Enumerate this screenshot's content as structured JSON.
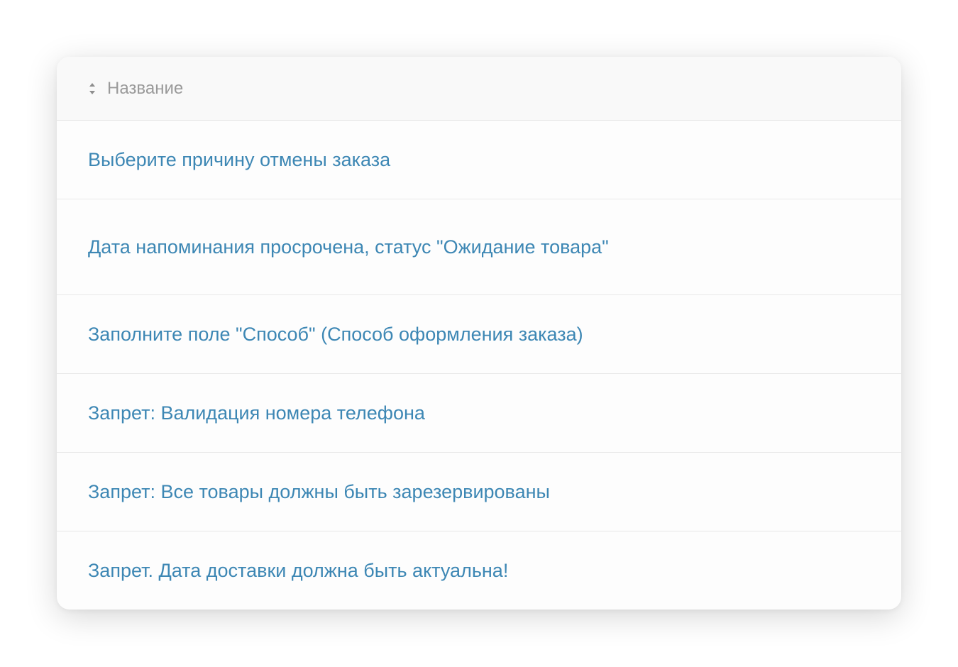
{
  "table": {
    "header": {
      "column_label": "Название",
      "sort_icon": "sort-updown-icon"
    },
    "rows": [
      {
        "label": "Выберите причину отмены заказа"
      },
      {
        "label": "Дата напоминания просрочена, статус \"Ожидание товара\""
      },
      {
        "label": "Заполните поле \"Способ\" (Способ оформления заказа)"
      },
      {
        "label": "Запрет: Валидация номера телефона"
      },
      {
        "label": "Запрет: Все товары должны быть зарезервированы"
      },
      {
        "label": "Запрет. Дата доставки должна быть актуальна!"
      }
    ]
  },
  "colors": {
    "link": "#3d87b4",
    "header_text": "#9a9a9a",
    "header_bg": "#f9f9f9",
    "divider": "#e8e8e8"
  }
}
